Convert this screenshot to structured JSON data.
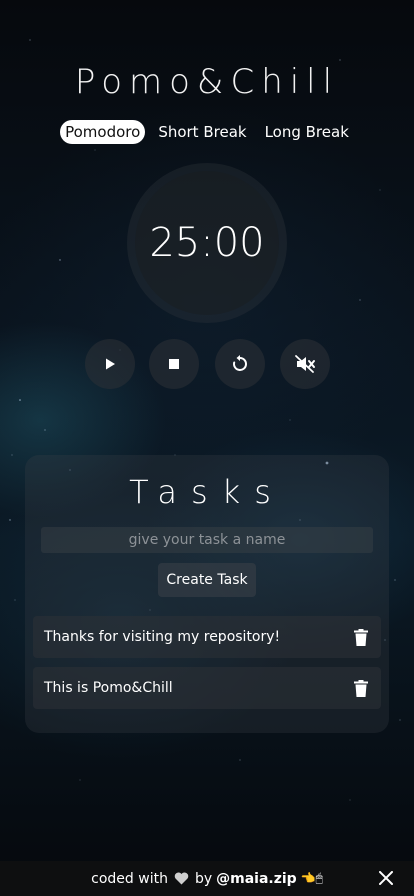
{
  "app": {
    "title": "Pomo&Chill"
  },
  "modes": [
    {
      "label": "Pomodoro",
      "active": true
    },
    {
      "label": "Short Break",
      "active": false
    },
    {
      "label": "Long Break",
      "active": false
    }
  ],
  "timer": {
    "display": "25:00"
  },
  "controls": [
    {
      "name": "play-button",
      "icon": "play-icon"
    },
    {
      "name": "stop-button",
      "icon": "stop-icon"
    },
    {
      "name": "restart-button",
      "icon": "restart-icon"
    },
    {
      "name": "mute-button",
      "icon": "volume-mute-icon"
    }
  ],
  "tasks": {
    "title": "Tasks",
    "input_placeholder": "give your task a name",
    "input_value": "",
    "create_label": "Create Task",
    "items": [
      {
        "text": "Thanks for visiting my repository!"
      },
      {
        "text": "This is Pomo&Chill"
      }
    ]
  },
  "footer": {
    "prefix": "coded with",
    "by": "by",
    "handle": "@maia.zip",
    "emojis": "👈🖱"
  },
  "colors": {
    "accent": "#ffffff",
    "background": "#0a1520",
    "card": "#3c4248"
  }
}
